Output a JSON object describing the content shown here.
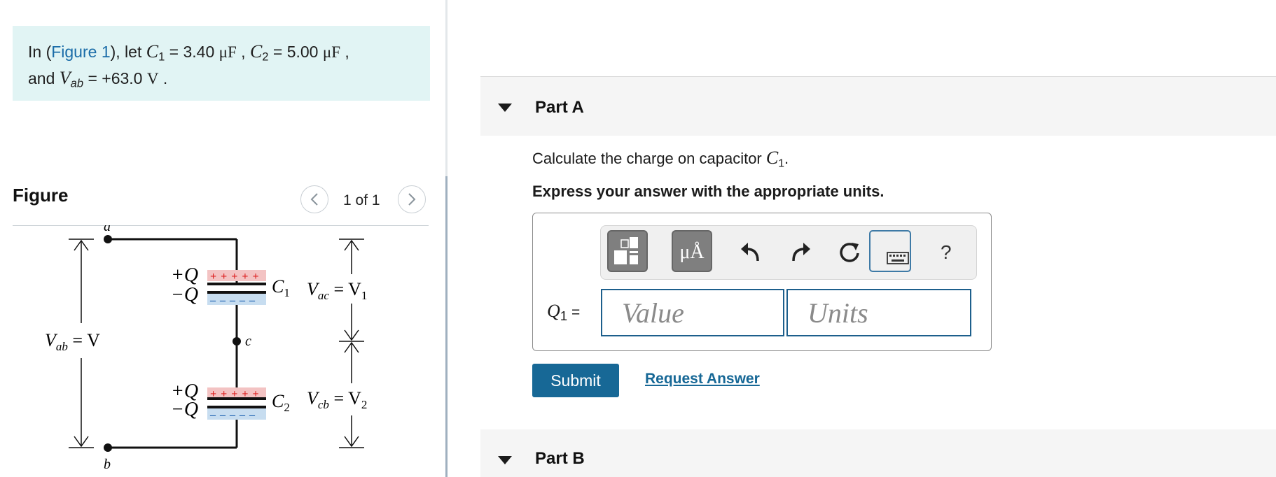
{
  "intro": {
    "prefix": "In (",
    "figure_link": "Figure 1",
    "text_after_link": "), let ",
    "c1_symbol": "C",
    "c1_sub": "1",
    "c1_value": " = 3.40 ",
    "c1_unit": "μF",
    "sep1": " , ",
    "c2_symbol": "C",
    "c2_sub": "2",
    "c2_value": " = 5.00 ",
    "c2_unit": "μF",
    "sep2": " ,",
    "and": "and ",
    "vab_symbol": "V",
    "vab_sub": "ab",
    "vab_value": " = +63.0 ",
    "vab_unit": "V",
    "end": " ."
  },
  "figure": {
    "heading": "Figure",
    "page_indicator": "1 of 1",
    "prev_icon": "chevron-left-icon",
    "next_icon": "chevron-right-icon",
    "labels": {
      "node_a": "a",
      "node_b": "b",
      "node_c": "c",
      "plus_q": "+Q",
      "minus_q": "−Q",
      "c1": "C",
      "c1_sub": "1",
      "c2": "C",
      "c2_sub": "2",
      "vab": "V",
      "vab_sub": "ab",
      "vab_eq": " = V",
      "vac": "V",
      "vac_sub": "ac",
      "vac_eq": " = V",
      "vac_eq_sub": "1",
      "vcb": "V",
      "vcb_sub": "cb",
      "vcb_eq": " = V",
      "vcb_eq_sub": "2",
      "plus_signs": "+ + + + +",
      "minus_signs": "– – – – –"
    }
  },
  "part_a": {
    "label": "Part A",
    "question_prefix": "Calculate the charge on capacitor ",
    "question_symbol": "C",
    "question_sub": "1",
    "question_suffix": ".",
    "instruction": "Express your answer with the appropriate units.",
    "answer_label": "Q",
    "answer_label_sub": "1",
    "answer_label_eq": " =",
    "value_placeholder": "Value",
    "units_placeholder": "Units",
    "toolbar": {
      "templates_icon": "templates-icon",
      "units_icon_text": "μÅ",
      "undo_icon": "undo-icon",
      "redo_icon": "redo-icon",
      "reset_icon": "reset-icon",
      "keyboard_icon": "keyboard-icon",
      "help_label": "?"
    },
    "submit_label": "Submit",
    "request_answer_label": "Request Answer"
  },
  "part_b": {
    "label": "Part B"
  },
  "colors": {
    "intro_bg": "#e1f4f4",
    "link": "#1a6ca8",
    "submit_bg": "#176896",
    "input_border": "#1d5f8c",
    "plus_fill": "#f3c3c3",
    "minus_fill": "#c7ddf0"
  }
}
